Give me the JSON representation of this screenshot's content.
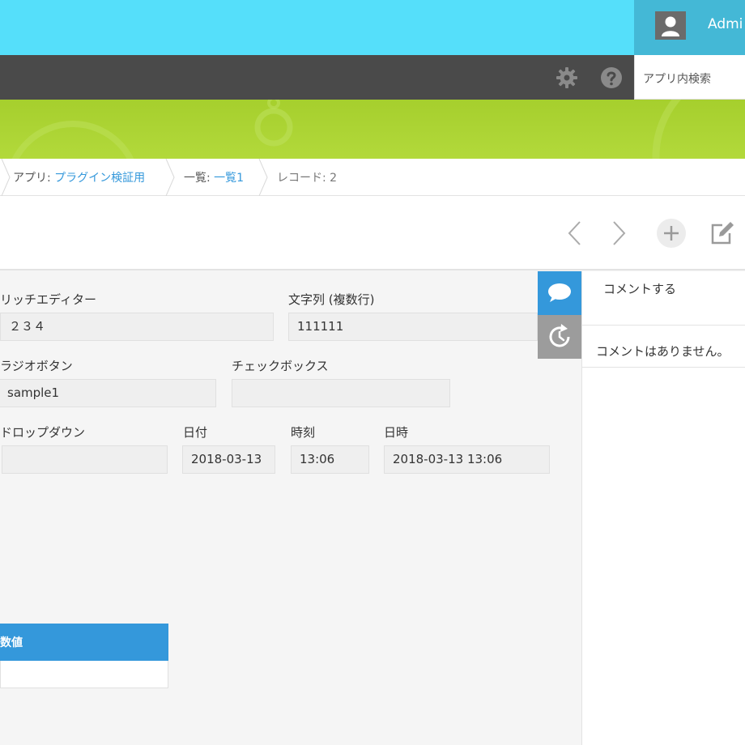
{
  "header": {
    "user_name": "Admi",
    "search_placeholder": "アプリ内検索"
  },
  "icons": {
    "avatar": "user-avatar-icon",
    "settings": "gear-icon",
    "help": "question-circle-icon",
    "comment_tab": "speech-bubble-icon",
    "history_tab": "history-icon",
    "prev": "chevron-left-icon",
    "next": "chevron-right-icon",
    "add": "plus-icon",
    "edit": "pencil-square-icon"
  },
  "breadcrumb": {
    "app_prefix": "アプリ: ",
    "app_name": "プラグイン検証用",
    "view_prefix": "一覧: ",
    "view_name": "一覧1",
    "record": "レコード: 2"
  },
  "fields": {
    "rich_editor": {
      "label": "リッチエディター",
      "value": "２３４"
    },
    "multiline": {
      "label": "文字列 (複数行)",
      "value": "111111"
    },
    "radio": {
      "label": "ラジオボタン",
      "value": "sample1"
    },
    "checkbox": {
      "label": "チェックボックス",
      "value": ""
    },
    "dropdown": {
      "label": "ドロップダウン",
      "value": ""
    },
    "date": {
      "label": "日付",
      "value": "2018-03-13"
    },
    "time": {
      "label": "時刻",
      "value": "13:06"
    },
    "datetime": {
      "label": "日時",
      "value": "2018-03-13 13:06"
    }
  },
  "table": {
    "header": "数値",
    "cell": ""
  },
  "comments": {
    "post_label": "コメントする",
    "empty_text": "コメントはありません。"
  },
  "colors": {
    "header_cyan": "#55dffa",
    "user_area": "#44b8d6",
    "dark_bar": "#4a4a4a",
    "banner_green": "#a6cf2d",
    "accent_blue": "#3498db",
    "link_blue": "#3498db"
  }
}
